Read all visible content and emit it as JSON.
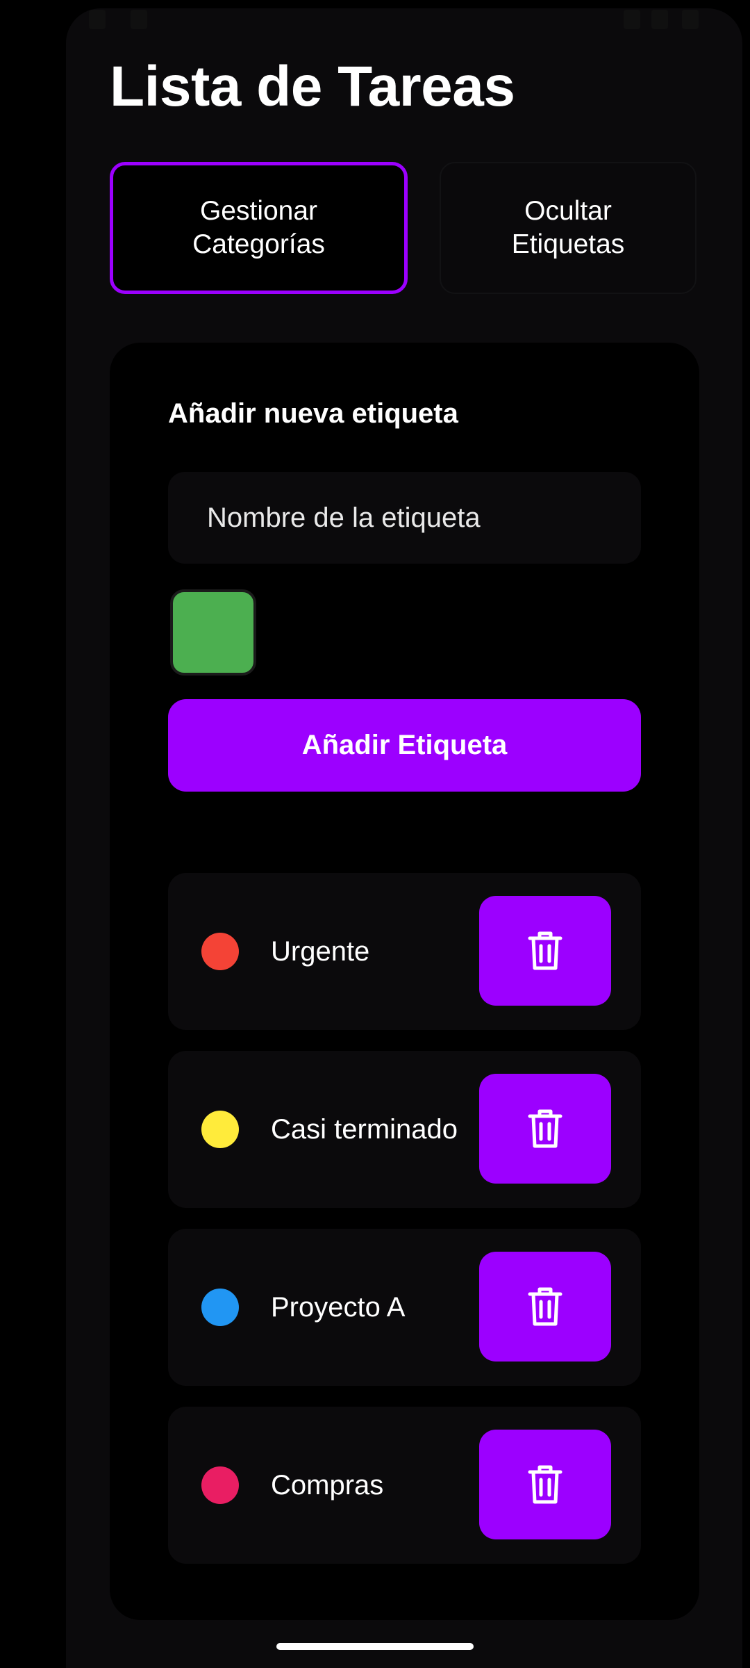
{
  "app": {
    "title": "Lista de Tareas"
  },
  "top_buttons": {
    "manage_categories": "Gestionar Categorías",
    "hide_tags": "Ocultar Etiquetas"
  },
  "new_tag": {
    "heading": "Añadir nueva etiqueta",
    "name_value": "",
    "name_placeholder": "Nombre de la etiqueta",
    "selected_color": "#4caf50",
    "add_button_label": "Añadir Etiqueta"
  },
  "tags": [
    {
      "label": "Urgente",
      "color": "#f44336"
    },
    {
      "label": "Casi terminado",
      "color": "#ffeb3b"
    },
    {
      "label": "Proyecto A",
      "color": "#2196f3"
    },
    {
      "label": "Compras",
      "color": "#e91e63"
    }
  ],
  "icons": {
    "delete": "trash-icon"
  },
  "theme": {
    "accent": "#9c00ff",
    "surface": "#0b0a0c",
    "background": "#000000"
  }
}
